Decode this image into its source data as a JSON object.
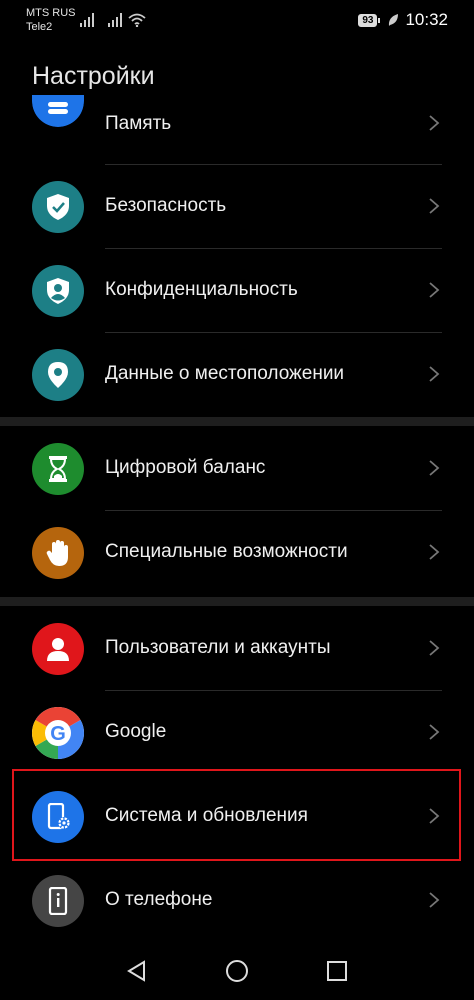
{
  "status_bar": {
    "carrier_1": "MTS RUS",
    "carrier_2": "Tele2",
    "battery": "93",
    "time": "10:32"
  },
  "page_title": "Настройки",
  "items": [
    {
      "label": "Память",
      "icon": "storage-icon",
      "color": "#1e74e8"
    },
    {
      "label": "Безопасность",
      "icon": "shield-check-icon",
      "color": "#1d7f86"
    },
    {
      "label": "Конфиденциальность",
      "icon": "privacy-shield-icon",
      "color": "#1d7f86"
    },
    {
      "label": "Данные о местоположении",
      "icon": "location-pin-icon",
      "color": "#1d7f86"
    },
    {
      "label": "Цифровой баланс",
      "icon": "hourglass-icon",
      "color": "#1e8c2e"
    },
    {
      "label": "Специальные возможности",
      "icon": "hand-icon",
      "color": "#b5650d"
    },
    {
      "label": "Пользователи и аккаунты",
      "icon": "user-icon",
      "color": "#e0161b"
    },
    {
      "label": "Google",
      "icon": "google-icon",
      "color": "#ffffff"
    },
    {
      "label": "Система и обновления",
      "icon": "phone-gear-icon",
      "color": "#1e74e8"
    },
    {
      "label": "О телефоне",
      "icon": "phone-info-icon",
      "color": "#454545"
    }
  ],
  "highlighted_item": "Система и обновления",
  "nav": {
    "back": "back-icon",
    "home": "home-icon",
    "recents": "recents-icon"
  }
}
